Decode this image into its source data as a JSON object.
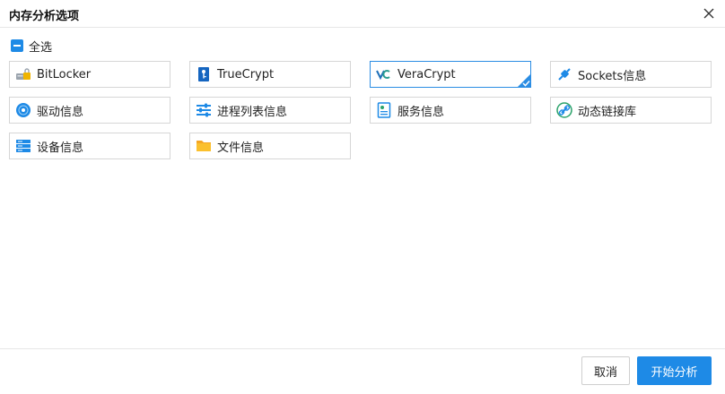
{
  "dialog": {
    "title": "内存分析选项",
    "select_all_label": "全选"
  },
  "options": [
    {
      "label": "BitLocker",
      "icon": "drive-lock-icon",
      "selected": false
    },
    {
      "label": "TrueCrypt",
      "icon": "truecrypt-icon",
      "selected": false
    },
    {
      "label": "VeraCrypt",
      "icon": "veracrypt-icon",
      "selected": true
    },
    {
      "label": "Sockets信息",
      "icon": "plug-icon",
      "selected": false
    },
    {
      "label": "驱动信息",
      "icon": "disc-icon",
      "selected": false
    },
    {
      "label": "进程列表信息",
      "icon": "sliders-icon",
      "selected": false
    },
    {
      "label": "服务信息",
      "icon": "service-doc-icon",
      "selected": false
    },
    {
      "label": "动态链接库",
      "icon": "link-icon",
      "selected": false
    },
    {
      "label": "设备信息",
      "icon": "server-icon",
      "selected": false
    },
    {
      "label": "文件信息",
      "icon": "folder-icon",
      "selected": false
    }
  ],
  "footer": {
    "cancel_label": "取消",
    "start_label": "开始分析"
  },
  "colors": {
    "accent": "#1e8ae6",
    "border": "#d6d6d6"
  }
}
